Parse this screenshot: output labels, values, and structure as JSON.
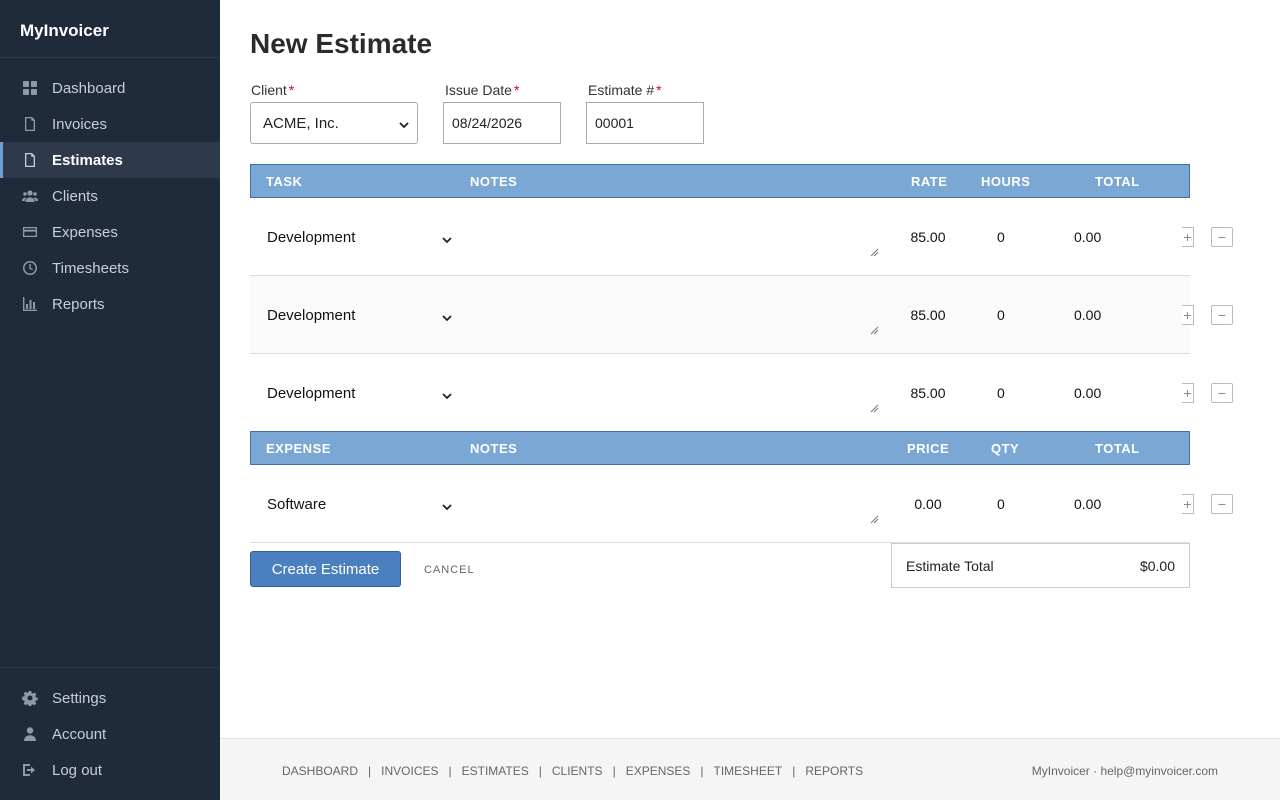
{
  "app": {
    "name": "MyInvoicer"
  },
  "sidebar": {
    "items": [
      {
        "label": "Dashboard",
        "icon": "dashboard-icon"
      },
      {
        "label": "Invoices",
        "icon": "document-icon"
      },
      {
        "label": "Estimates",
        "icon": "document-icon",
        "active": true
      },
      {
        "label": "Clients",
        "icon": "users-icon"
      },
      {
        "label": "Expenses",
        "icon": "credit-card-icon"
      },
      {
        "label": "Timesheets",
        "icon": "clock-icon"
      },
      {
        "label": "Reports",
        "icon": "bar-chart-icon"
      }
    ],
    "bottom_items": [
      {
        "label": "Settings",
        "icon": "gear-icon"
      },
      {
        "label": "Account",
        "icon": "user-icon"
      },
      {
        "label": "Log out",
        "icon": "logout-icon"
      }
    ]
  },
  "page": {
    "title": "New Estimate"
  },
  "form": {
    "client": {
      "label": "Client",
      "value": "ACME, Inc."
    },
    "issue_date": {
      "label": "Issue Date",
      "value": "08/24/2026"
    },
    "estimate_number": {
      "label": "Estimate #",
      "value": "00001"
    },
    "required_marker": "*"
  },
  "task_table": {
    "headers": [
      "TASK",
      "NOTES",
      "RATE",
      "HOURS",
      "TOTAL"
    ],
    "rows": [
      {
        "task": "Development",
        "notes": "",
        "rate": "85.00",
        "hours": "0",
        "total": "0.00"
      },
      {
        "task": "Development",
        "notes": "",
        "rate": "85.00",
        "hours": "0",
        "total": "0.00"
      },
      {
        "task": "Development",
        "notes": "",
        "rate": "85.00",
        "hours": "0",
        "total": "0.00"
      }
    ]
  },
  "expense_table": {
    "headers": [
      "EXPENSE",
      "NOTES",
      "PRICE",
      "QTY",
      "TOTAL"
    ],
    "rows": [
      {
        "expense": "Software",
        "notes": "",
        "price": "0.00",
        "qty": "0",
        "total": "0.00"
      }
    ]
  },
  "row_buttons": {
    "add": "+",
    "remove": "−"
  },
  "actions": {
    "create_label": "Create Estimate",
    "cancel_label": "CANCEL"
  },
  "summary": {
    "label": "Estimate Total",
    "value": "$0.00"
  },
  "footer": {
    "links": [
      "DASHBOARD",
      "INVOICES",
      "ESTIMATES",
      "CLIENTS",
      "EXPENSES",
      "TIMESHEET",
      "REPORTS"
    ],
    "separator": "|",
    "contact": "MyInvoicer · help@myinvoicer.com"
  },
  "colors": {
    "sidebar_bg": "#1f2a3a",
    "header_bg": "#7aa7d4",
    "primary": "#4a80bf",
    "required": "#d0021b"
  }
}
